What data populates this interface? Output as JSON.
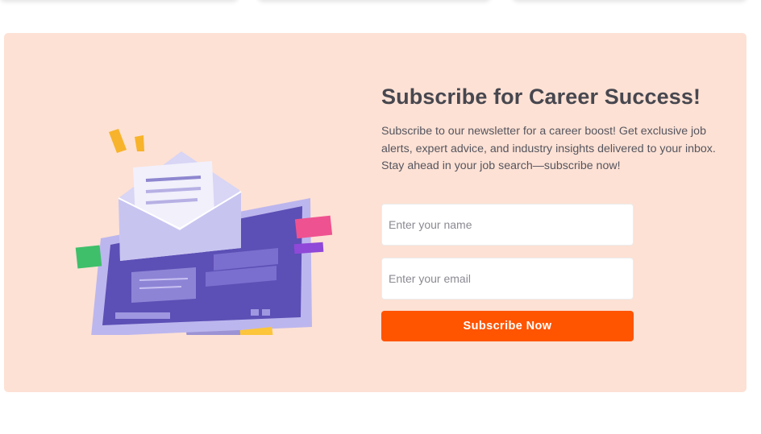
{
  "subscribe": {
    "title": "Subscribe for Career Success!",
    "description": "Subscribe to our newsletter for a career boost! Get exclusive job alerts, expert advice, and industry insights delivered to your inbox. Stay ahead in your job search—subscribe now!",
    "name_placeholder": "Enter your name",
    "email_placeholder": "Enter your email",
    "button_label": "Subscribe Now"
  },
  "colors": {
    "section_background": "#fde1d4",
    "button_background": "#ff5400",
    "title_text": "#47474f"
  },
  "illustration": {
    "icon": "newsletter-monitor-envelope-illustration"
  }
}
